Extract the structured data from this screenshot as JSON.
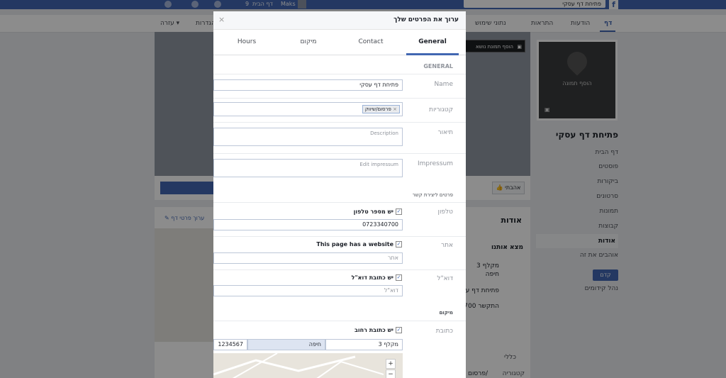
{
  "topbar": {
    "search_value": "פתיחת דף עסקי",
    "user_name": "Maks",
    "home_label": "דף הבית",
    "home_count": "9",
    "logo": "f",
    "icons": [
      "friends-icon",
      "messenger-icon",
      "notifications-icon",
      "help-icon"
    ]
  },
  "page_nav": {
    "tabs": [
      "דף",
      "הודעות",
      "התראות",
      "נתוני שימוש",
      "הגדרות",
      "עזרה ▾"
    ]
  },
  "sidebar": {
    "profile_placeholder": "הוסף תמונה",
    "page_name": "פתיחת דף עסקי",
    "items": [
      "דף הבית",
      "פוסטים",
      "ביקורות",
      "סרטונים",
      "תמונות",
      "קבוצות",
      "אודות",
      "אוהבים את זה"
    ],
    "active_index": 6,
    "promote_label": "קדם",
    "manage_promotions": "נהל קידומים"
  },
  "cover": {
    "add_cover_label": "הוסף תמונת נושא"
  },
  "actions": {
    "like_label": "אהבתי"
  },
  "about": {
    "title": "אודות",
    "edit_label": "ערוך פרטי דף",
    "find_us": "מצא אותנו",
    "address_line1": "מקלף 3",
    "address_line2": "חיפה",
    "messenger_line": "פתיחת דף עסקי",
    "phone_line": "התקשר 4-0700",
    "general": "כללי",
    "category_label": "קטגוריה",
    "category_value": "פרסום/"
  },
  "modal": {
    "title": "ערוך את הפרטים שלך",
    "close": "×",
    "tabs": [
      "General",
      "Contact",
      "מיקום",
      "Hours"
    ],
    "active_tab": "General",
    "general_section": "GENERAL",
    "name_label": "Name",
    "name_value": "פתיחת דף עסקי",
    "categories_label": "קטגוריות",
    "category_tag": "פרסום/שיווק",
    "description_label": "תיאור",
    "description_placeholder": "Description",
    "impressum_label": "Impressum",
    "impressum_placeholder": "Edit impressum",
    "contact_section": "פרטים ליצירת קשר",
    "phone_label": "טלפון",
    "phone_checkbox": "יש מספר טלפון",
    "phone_value": "0723340700",
    "website_label": "אתר",
    "website_checkbox": "This page has a website",
    "website_placeholder": "אתר",
    "email_label": "דוא\"ל",
    "email_checkbox": "יש כתובת דוא\"ל",
    "email_placeholder": "דוא\"ל",
    "location_section": "מיקום",
    "address_label": "כתובת",
    "address_checkbox": "יש כתובת רחוב",
    "street_value": "מקלף 3",
    "city_value": "חיפה",
    "zip_value": "1234567",
    "zoom_in": "+",
    "zoom_out": "−"
  }
}
